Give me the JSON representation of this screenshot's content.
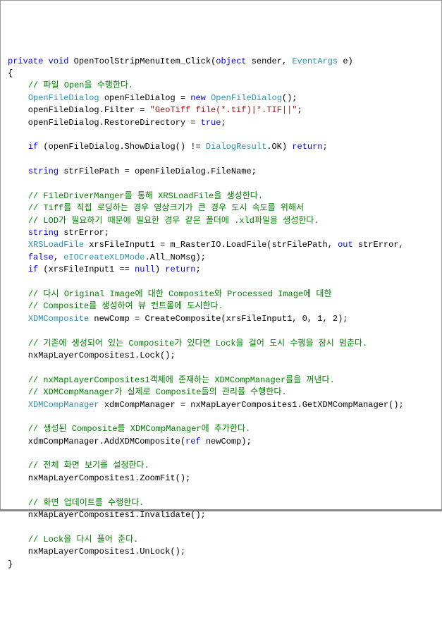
{
  "code": {
    "tokens": [
      {
        "cls": "kw",
        "t": "private"
      },
      {
        "cls": "text",
        "t": " "
      },
      {
        "cls": "kw",
        "t": "void"
      },
      {
        "cls": "text",
        "t": " OpenToolStripMenuItem_Click("
      },
      {
        "cls": "kw",
        "t": "object"
      },
      {
        "cls": "text",
        "t": " sender, "
      },
      {
        "cls": "type",
        "t": "EventArgs"
      },
      {
        "cls": "text",
        "t": " e)\n{\n    "
      },
      {
        "cls": "cmt",
        "t": "// 파일 Open을 수행한다."
      },
      {
        "cls": "text",
        "t": "\n    "
      },
      {
        "cls": "type",
        "t": "OpenFileDialog"
      },
      {
        "cls": "text",
        "t": " openFileDialog = "
      },
      {
        "cls": "kw",
        "t": "new"
      },
      {
        "cls": "text",
        "t": " "
      },
      {
        "cls": "type",
        "t": "OpenFileDialog"
      },
      {
        "cls": "text",
        "t": "();\n    openFileDialog.Filter = "
      },
      {
        "cls": "str",
        "t": "\"GeoTiff file(*.tif)|*.TIF||\""
      },
      {
        "cls": "text",
        "t": ";\n    openFileDialog.RestoreDirectory = "
      },
      {
        "cls": "kw",
        "t": "true"
      },
      {
        "cls": "text",
        "t": ";\n\n    "
      },
      {
        "cls": "kw",
        "t": "if"
      },
      {
        "cls": "text",
        "t": " (openFileDialog.ShowDialog() != "
      },
      {
        "cls": "type",
        "t": "DialogResult"
      },
      {
        "cls": "text",
        "t": ".OK) "
      },
      {
        "cls": "kw",
        "t": "return"
      },
      {
        "cls": "text",
        "t": ";\n\n    "
      },
      {
        "cls": "kw",
        "t": "string"
      },
      {
        "cls": "text",
        "t": " strFilePath = openFileDialog.FileName;\n\n    "
      },
      {
        "cls": "cmt",
        "t": "// FileDriverManger를 통해 XRSLoadFile을 생성한다."
      },
      {
        "cls": "text",
        "t": "\n    "
      },
      {
        "cls": "cmt",
        "t": "// Tiff를 직접 로딩하는 경우 영상크기가 큰 경우 도시 속도를 위해서"
      },
      {
        "cls": "text",
        "t": "\n    "
      },
      {
        "cls": "cmt",
        "t": "// LOD가 필요하기 때문에 필요한 경우 같은 폴더에 .xld파일을 생성한다."
      },
      {
        "cls": "text",
        "t": "\n    "
      },
      {
        "cls": "kw",
        "t": "string"
      },
      {
        "cls": "text",
        "t": " strError;\n    "
      },
      {
        "cls": "type",
        "t": "XRSLoadFile"
      },
      {
        "cls": "text",
        "t": " xrsFileInput1 = m_RasterIO.LoadFile(strFilePath, "
      },
      {
        "cls": "kw",
        "t": "out"
      },
      {
        "cls": "text",
        "t": " strError, \n    "
      },
      {
        "cls": "kw",
        "t": "false"
      },
      {
        "cls": "text",
        "t": ", "
      },
      {
        "cls": "type",
        "t": "eIOCreateXLDMode"
      },
      {
        "cls": "text",
        "t": ".All_NoMsg);\n    "
      },
      {
        "cls": "kw",
        "t": "if"
      },
      {
        "cls": "text",
        "t": " (xrsFileInput1 == "
      },
      {
        "cls": "kw",
        "t": "null"
      },
      {
        "cls": "text",
        "t": ") "
      },
      {
        "cls": "kw",
        "t": "return"
      },
      {
        "cls": "text",
        "t": ";\n\n    "
      },
      {
        "cls": "cmt",
        "t": "// 다시 Original Image에 대한 Composite와 Processed Image에 대한"
      },
      {
        "cls": "text",
        "t": "\n    "
      },
      {
        "cls": "cmt",
        "t": "// Composite를 생성하여 뷰 컨트롤에 도시한다."
      },
      {
        "cls": "text",
        "t": "\n    "
      },
      {
        "cls": "type",
        "t": "XDMComposite"
      },
      {
        "cls": "text",
        "t": " newComp = CreateComposite(xrsFileInput1, 0, 1, 2);\n\n    "
      },
      {
        "cls": "cmt",
        "t": "// 기존에 생성되어 있는 Composite가 있다면 Lock을 걸어 도시 수행을 잠시 멈춘다."
      },
      {
        "cls": "text",
        "t": "\n    nxMapLayerComposites1.Lock();\n\n    "
      },
      {
        "cls": "cmt",
        "t": "// nxMapLayerComposites1객체에 존재하는 XDMCompManager를을 꺼낸다."
      },
      {
        "cls": "text",
        "t": "\n    "
      },
      {
        "cls": "cmt",
        "t": "// XDMCompManager가 실제로 Composite들의 관리를 수행한다."
      },
      {
        "cls": "text",
        "t": "\n    "
      },
      {
        "cls": "type",
        "t": "XDMCompManager"
      },
      {
        "cls": "text",
        "t": " xdmCompManager = nxMapLayerComposites1.GetXDMCompManager();\n\n    "
      },
      {
        "cls": "cmt",
        "t": "// 생성된 Composite를 XDMCompManager에 추가한다."
      },
      {
        "cls": "text",
        "t": "\n    xdmCompManager.AddXDMComposite("
      },
      {
        "cls": "kw",
        "t": "ref"
      },
      {
        "cls": "text",
        "t": " newComp);\n\n    "
      },
      {
        "cls": "cmt",
        "t": "// 전체 화면 보기를 설정한다."
      },
      {
        "cls": "text",
        "t": "\n    nxMapLayerComposites1.ZoomFit();\n\n    "
      },
      {
        "cls": "cmt",
        "t": "// 화면 업데이트를 수행한다."
      },
      {
        "cls": "text",
        "t": "\n    nxMapLayerComposites1.Invalidate();\n\n    "
      },
      {
        "cls": "cmt",
        "t": "// Lock을 다시 풀어 준다."
      },
      {
        "cls": "text",
        "t": "\n    nxMapLayerComposites1.UnLock();\n}\n"
      }
    ]
  }
}
